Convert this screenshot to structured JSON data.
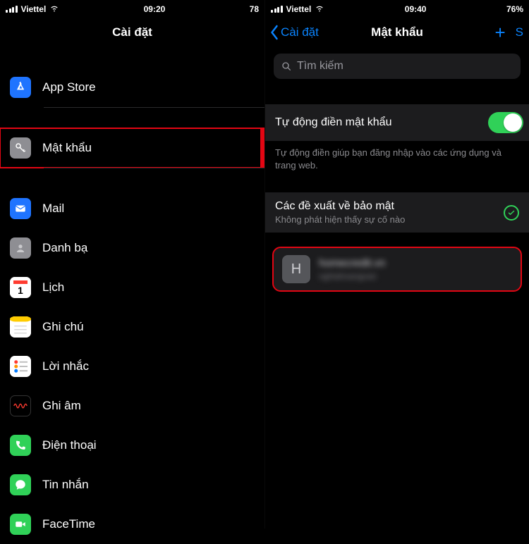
{
  "left": {
    "status": {
      "carrier": "Viettel",
      "time": "09:20",
      "battery": "78"
    },
    "title": "Cài đặt",
    "rows": [
      {
        "id": "appstore",
        "label": "App Store",
        "icon_bg": "#1f74ff",
        "icon": "appstore"
      },
      {
        "id": "passwords",
        "label": "Mật khẩu",
        "icon_bg": "#8e8e93",
        "icon": "key",
        "highlighted": true
      },
      {
        "id": "mail",
        "label": "Mail",
        "icon_bg": "#1f74ff",
        "icon": "mail"
      },
      {
        "id": "contacts",
        "label": "Danh bạ",
        "icon_bg": "#8e8e93",
        "icon": "contacts"
      },
      {
        "id": "calendar",
        "label": "Lịch",
        "icon_bg": "#ffffff",
        "icon": "calendar"
      },
      {
        "id": "notes",
        "label": "Ghi chú",
        "icon_bg": "#ffffff",
        "icon": "notes"
      },
      {
        "id": "reminders",
        "label": "Lời nhắc",
        "icon_bg": "#ffffff",
        "icon": "reminders"
      },
      {
        "id": "voicememos",
        "label": "Ghi âm",
        "icon_bg": "#000000",
        "icon": "voicememo"
      },
      {
        "id": "phone",
        "label": "Điện thoại",
        "icon_bg": "#30d158",
        "icon": "phone"
      },
      {
        "id": "messages",
        "label": "Tin nhắn",
        "icon_bg": "#30d158",
        "icon": "messages"
      },
      {
        "id": "facetime",
        "label": "FaceTime",
        "icon_bg": "#30d158",
        "icon": "facetime"
      }
    ]
  },
  "right": {
    "status": {
      "carrier": "Viettel",
      "time": "09:40",
      "battery": "76%"
    },
    "back_label": "Cài đặt",
    "title": "Mật khẩu",
    "edit_partial": "S",
    "search_placeholder": "Tìm kiếm",
    "autofill": {
      "label": "Tự động điền mật khẩu",
      "footer": "Tự động điền giúp bạn đăng nhập vào các ứng dụng và trang web."
    },
    "recommend": {
      "title": "Các đề xuất về bảo mật",
      "subtitle": "Không phát hiện thấy sự cố nào"
    },
    "entry": {
      "avatar_letter": "H",
      "site": "homecredit.vn",
      "user": "nghiahoangvan"
    }
  }
}
